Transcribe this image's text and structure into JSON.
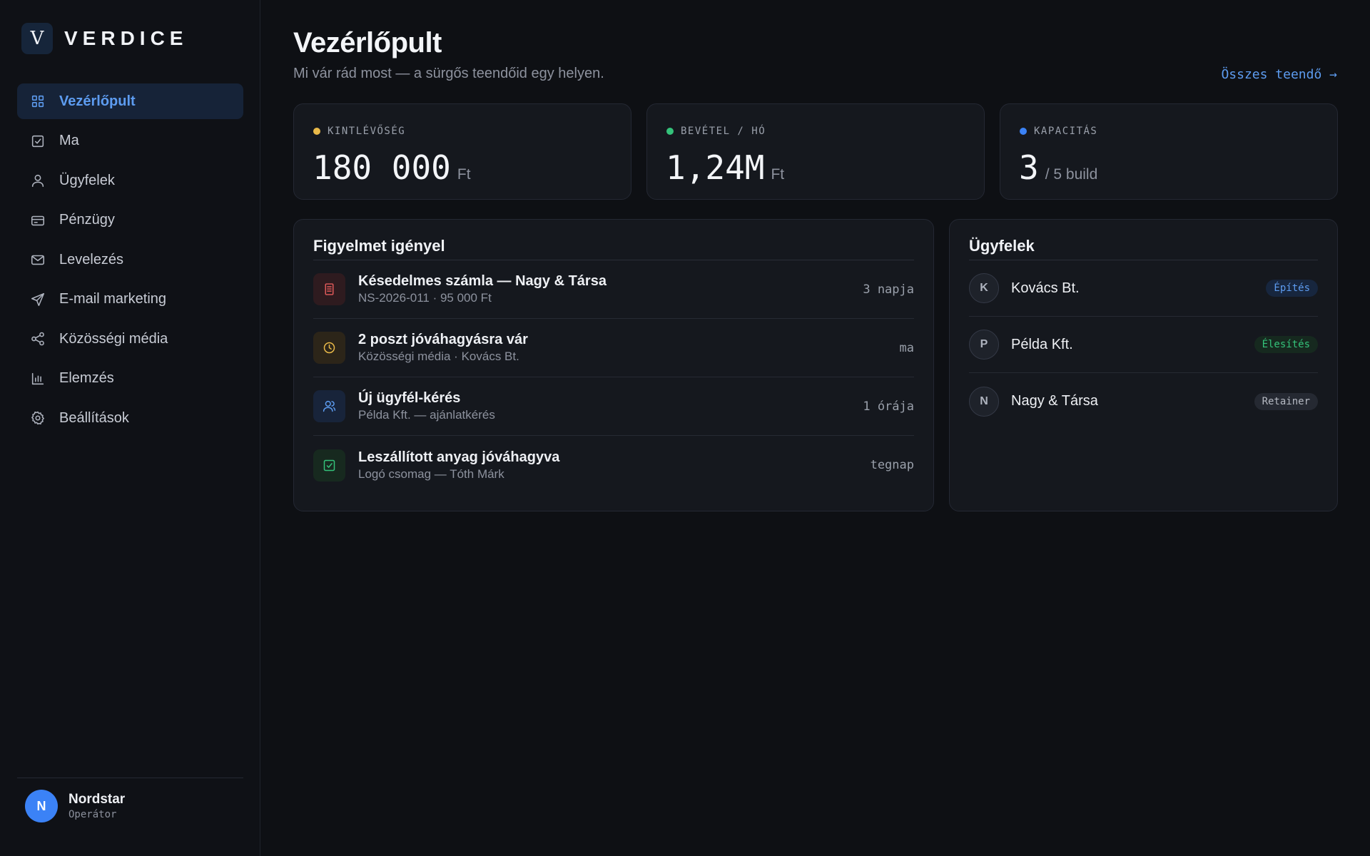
{
  "brand": {
    "logo_letter": "V",
    "name": "VERDICE"
  },
  "nav": [
    {
      "label": "Vezérlőpult",
      "icon": "grid-icon",
      "active": true
    },
    {
      "label": "Ma",
      "icon": "check-square-icon"
    },
    {
      "label": "Ügyfelek",
      "icon": "user-icon"
    },
    {
      "label": "Pénzügy",
      "icon": "credit-card-icon"
    },
    {
      "label": "Levelezés",
      "icon": "mail-icon"
    },
    {
      "label": "E-mail marketing",
      "icon": "send-icon"
    },
    {
      "label": "Közösségi média",
      "icon": "share-icon"
    },
    {
      "label": "Elemzés",
      "icon": "bar-chart-icon"
    },
    {
      "label": "Beállítások",
      "icon": "gear-icon"
    }
  ],
  "user": {
    "initial": "N",
    "name": "Nordstar",
    "role": "Operátor"
  },
  "header": {
    "title": "Vezérlőpult",
    "subtitle": "Mi vár rád most — a sürgős teendőid egy helyen.",
    "all_tasks_link": "Összes teendő →"
  },
  "stats": [
    {
      "label": "KINTLÉVŐSÉG",
      "value": "180 000",
      "unit": "Ft",
      "dot_color": "#e9b949"
    },
    {
      "label": "BEVÉTEL / HÓ",
      "value": "1,24M",
      "unit": "Ft",
      "dot_color": "#34c27a"
    },
    {
      "label": "KAPACITÁS",
      "value": "3",
      "unit": "/ 5 build",
      "dot_color": "#3b82f6"
    }
  ],
  "attention": {
    "title": "Figyelmet igényel",
    "items": [
      {
        "title": "Késedelmes számla — Nagy & Társa",
        "subtitle": "NS-2026-011 · 95 000 Ft",
        "time": "3 napja",
        "icon": "invoice-icon",
        "color": "#e05a5a",
        "bg": "#2e1b1f"
      },
      {
        "title": "2 poszt jóváhagyásra vár",
        "subtitle": "Közösségi média · Kovács Bt.",
        "time": "ma",
        "icon": "clock-icon",
        "color": "#e9b949",
        "bg": "#2c2519"
      },
      {
        "title": "Új ügyfél-kérés",
        "subtitle": "Példa Kft. — ajánlatkérés",
        "time": "1 órája",
        "icon": "user-icon",
        "color": "#5d9cf0",
        "bg": "#18243a"
      },
      {
        "title": "Leszállított anyag jóváhagyva",
        "subtitle": "Logó csomag — Tóth Márk",
        "time": "tegnap",
        "icon": "check-square-icon",
        "color": "#34c27a",
        "bg": "#17291f"
      }
    ]
  },
  "clients": {
    "title": "Ügyfelek",
    "items": [
      {
        "initial": "K",
        "name": "Kovács Bt.",
        "status": "Építés",
        "status_color": "#5d9cf0",
        "status_bg": "#17263e"
      },
      {
        "initial": "P",
        "name": "Példa Kft.",
        "status": "Élesítés",
        "status_color": "#34c27a",
        "status_bg": "#16291f"
      },
      {
        "initial": "N",
        "name": "Nagy & Társa",
        "status": "Retainer",
        "status_color": "#b6bac3",
        "status_bg": "#252932"
      }
    ]
  }
}
